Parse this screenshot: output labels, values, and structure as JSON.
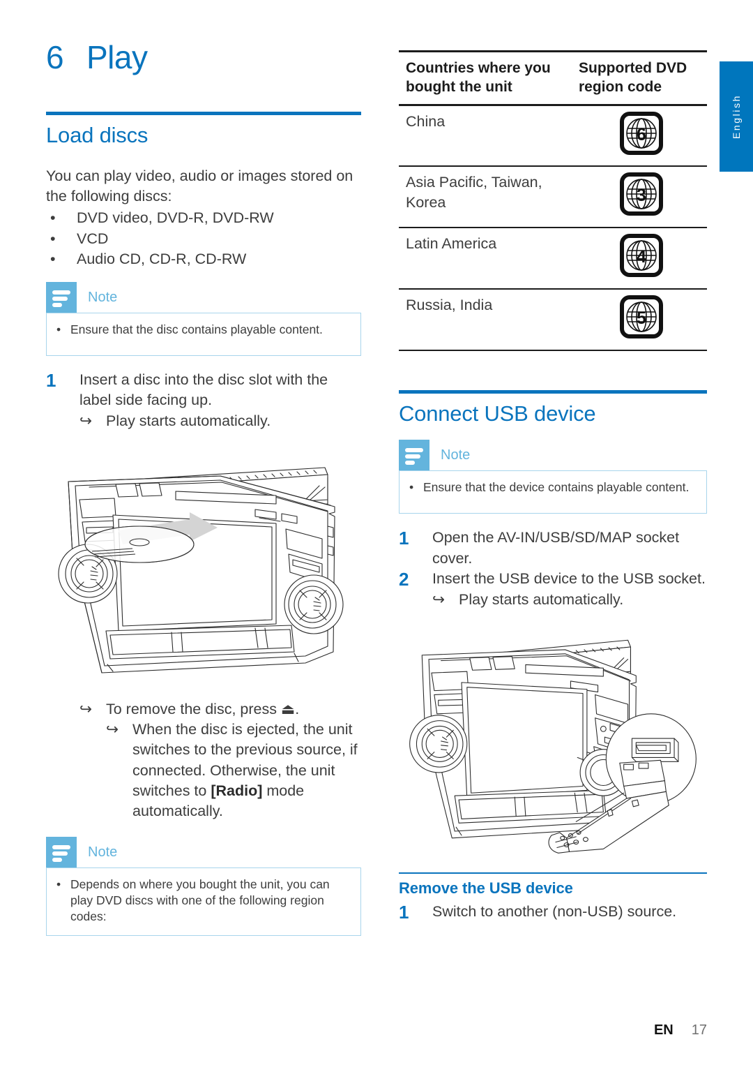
{
  "chapter": {
    "number": "6",
    "title": "Play"
  },
  "left": {
    "section_title": "Load discs",
    "intro": "You can play video, audio or images stored on the following discs:",
    "disc_types": [
      "DVD video, DVD-R, DVD-RW",
      "VCD",
      "Audio CD, CD-R, CD-RW"
    ],
    "bullet_char": "•",
    "note1": {
      "label": "Note",
      "items": [
        "Ensure that the disc contains playable content."
      ]
    },
    "step1": {
      "number": "1",
      "text": "Insert a disc into the disc slot with the label side facing up."
    },
    "step1_result": "Play starts automatically.",
    "arrow_char": "↪",
    "eject_result": "To remove the disc, press ⏏.",
    "eject_detail_pre": "When the disc is ejected, the unit switches to the previous source, if connected. Otherwise, the unit switches to ",
    "eject_detail_key": "[Radio]",
    "eject_detail_post": " mode automatically.",
    "note2": {
      "label": "Note",
      "items": [
        "Depends on where you bought the unit, you can play DVD discs with one of the following region codes:"
      ]
    },
    "figure_name": "car-head-unit-disc-insert-illustration"
  },
  "right": {
    "table": {
      "headers": [
        "Countries where you bought the unit",
        "Supported DVD region code"
      ],
      "rows": [
        {
          "countries": "China",
          "code": "6",
          "icon": "dvd-region-globe-icon"
        },
        {
          "countries": "Asia Pacific, Taiwan, Korea",
          "code": "3",
          "icon": "dvd-region-globe-icon"
        },
        {
          "countries": "Latin America",
          "code": "4",
          "icon": "dvd-region-globe-icon"
        },
        {
          "countries": "Russia, India",
          "code": "5",
          "icon": "dvd-region-globe-icon"
        }
      ]
    },
    "section_title": "Connect USB device",
    "note1": {
      "label": "Note",
      "items": [
        "Ensure that the device contains playable content."
      ]
    },
    "steps": [
      {
        "number": "1",
        "text": "Open the AV-IN/USB/SD/MAP socket cover."
      },
      {
        "number": "2",
        "text": "Insert the USB device to the USB socket."
      }
    ],
    "step2_result": "Play starts automatically.",
    "arrow_char": "↪",
    "figure_name": "car-head-unit-usb-insert-illustration",
    "subsection_title": "Remove the USB device",
    "remove_step": {
      "number": "1",
      "text": "Switch to another (non-USB) source."
    }
  },
  "language_tab": {
    "label": "English"
  },
  "footer": {
    "language": "EN",
    "page": "17"
  },
  "colors": {
    "accent_blue": "#0a74bd",
    "note_blue": "#63b4dd",
    "note_border": "#a8d5ec",
    "tab_blue": "#0076bd",
    "body_text": "#3d3d3d"
  }
}
